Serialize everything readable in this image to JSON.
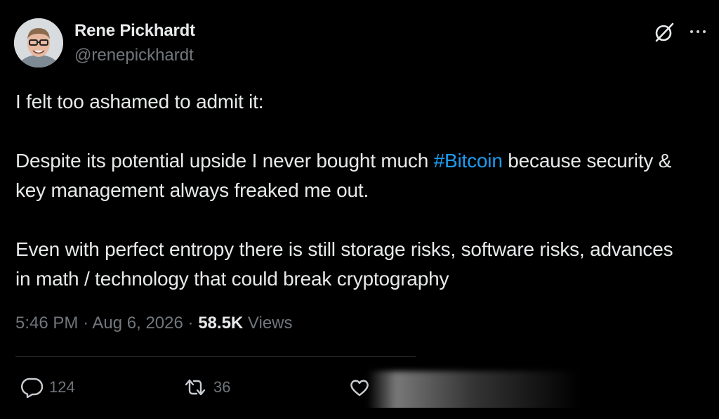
{
  "author": {
    "display_name": "Rene Pickhardt",
    "handle": "@renepickhardt",
    "avatar": "avatar"
  },
  "header_icons": [
    "grok-icon",
    "more-icon"
  ],
  "tweet": {
    "line1": "I felt too ashamed to admit it:",
    "para2_before": "Despite its potential upside I never bought much ",
    "hashtag": "#Bitcoin",
    "para2_after": " because security & key management always freaked me out.",
    "para3": "Even with perfect entropy there is still storage risks, software risks, advances in math / technology that could break cryptography"
  },
  "meta": {
    "time": "5:46 PM",
    "date": "Aug 6, 2026",
    "separator": "·",
    "views_count": "58.5K",
    "views_label": "Views"
  },
  "actions": {
    "reply_count": "124",
    "retweet_count": "36"
  },
  "colors": {
    "background": "#000000",
    "text": "#e7e9ea",
    "muted": "#71767b",
    "link": "#1d9bf0",
    "divider": "#2f3336"
  }
}
